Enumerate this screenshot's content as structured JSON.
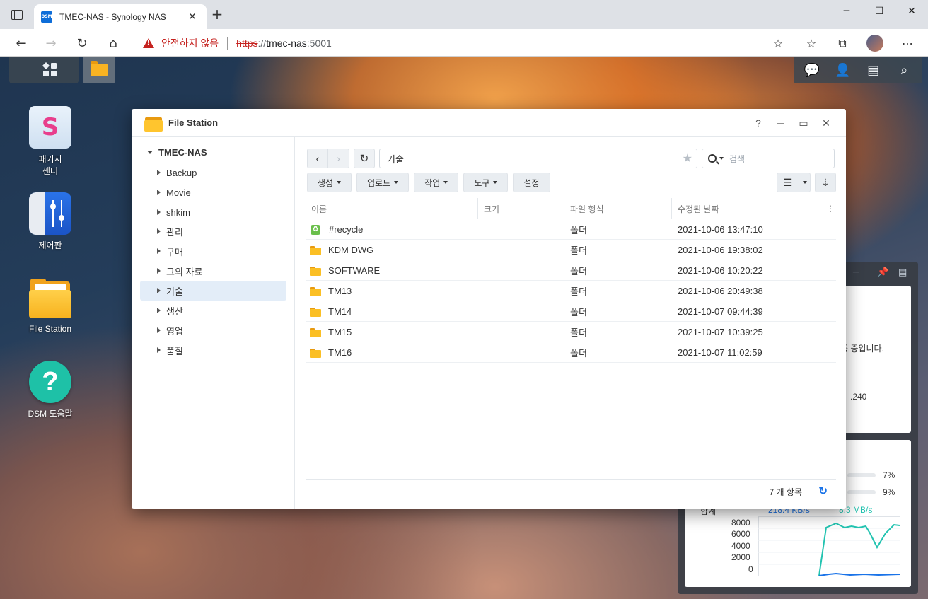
{
  "browser": {
    "tab_title": "TMEC-NAS - Synology NAS",
    "favicon_text": "DSM",
    "security_label": "안전하지 않음",
    "url_scheme": "https",
    "url_rest": "://",
    "url_host": "tmec-nas",
    "url_port": ":5001"
  },
  "desktop_icons": [
    {
      "label_line1": "패키지",
      "label_line2": "센터"
    },
    {
      "label_line1": "제어판",
      "label_line2": ""
    },
    {
      "label_line1": "File Station",
      "label_line2": ""
    },
    {
      "label_line1": "DSM 도움말",
      "label_line2": ""
    }
  ],
  "widgets": {
    "status_text": "동 중입니다.",
    "ip_fragment": ".240",
    "cpu_percent": "7%",
    "ram_percent": "9%",
    "upload_rate": "218.4 KB/s",
    "download_rate": "8.3 MB/s",
    "net_label": "합계",
    "y_ticks": [
      "8000",
      "6000",
      "4000",
      "2000",
      "0"
    ],
    "colors": {
      "upload": "#1a73e8",
      "download": "#22c3b0"
    }
  },
  "file_station": {
    "title": "File Station",
    "tree_root": "TMEC-NAS",
    "tree": [
      "Backup",
      "Movie",
      "shkim",
      "관리",
      "구매",
      "그외 자료",
      "기술",
      "생산",
      "영업",
      "품질"
    ],
    "selected_folder": "기술",
    "path": "기술",
    "search_placeholder": "검색",
    "actions": [
      "생성",
      "업로드",
      "작업",
      "도구",
      "설정"
    ],
    "columns": [
      "이름",
      "크기",
      "파일 형식",
      "수정된 날짜"
    ],
    "rows": [
      {
        "name": "#recycle",
        "size": "",
        "type": "폴더",
        "modified": "2021-10-06 13:47:10",
        "icon": "recycle-folder"
      },
      {
        "name": "KDM DWG",
        "size": "",
        "type": "폴더",
        "modified": "2021-10-06 19:38:02",
        "icon": "folder"
      },
      {
        "name": "SOFTWARE",
        "size": "",
        "type": "폴더",
        "modified": "2021-10-06 10:20:22",
        "icon": "folder"
      },
      {
        "name": "TM13",
        "size": "",
        "type": "폴더",
        "modified": "2021-10-06 20:49:38",
        "icon": "folder"
      },
      {
        "name": "TM14",
        "size": "",
        "type": "폴더",
        "modified": "2021-10-07 09:44:39",
        "icon": "folder"
      },
      {
        "name": "TM15",
        "size": "",
        "type": "폴더",
        "modified": "2021-10-07 10:39:25",
        "icon": "folder"
      },
      {
        "name": "TM16",
        "size": "",
        "type": "폴더",
        "modified": "2021-10-07 11:02:59",
        "icon": "folder"
      }
    ],
    "item_count": "7 개 항목"
  }
}
